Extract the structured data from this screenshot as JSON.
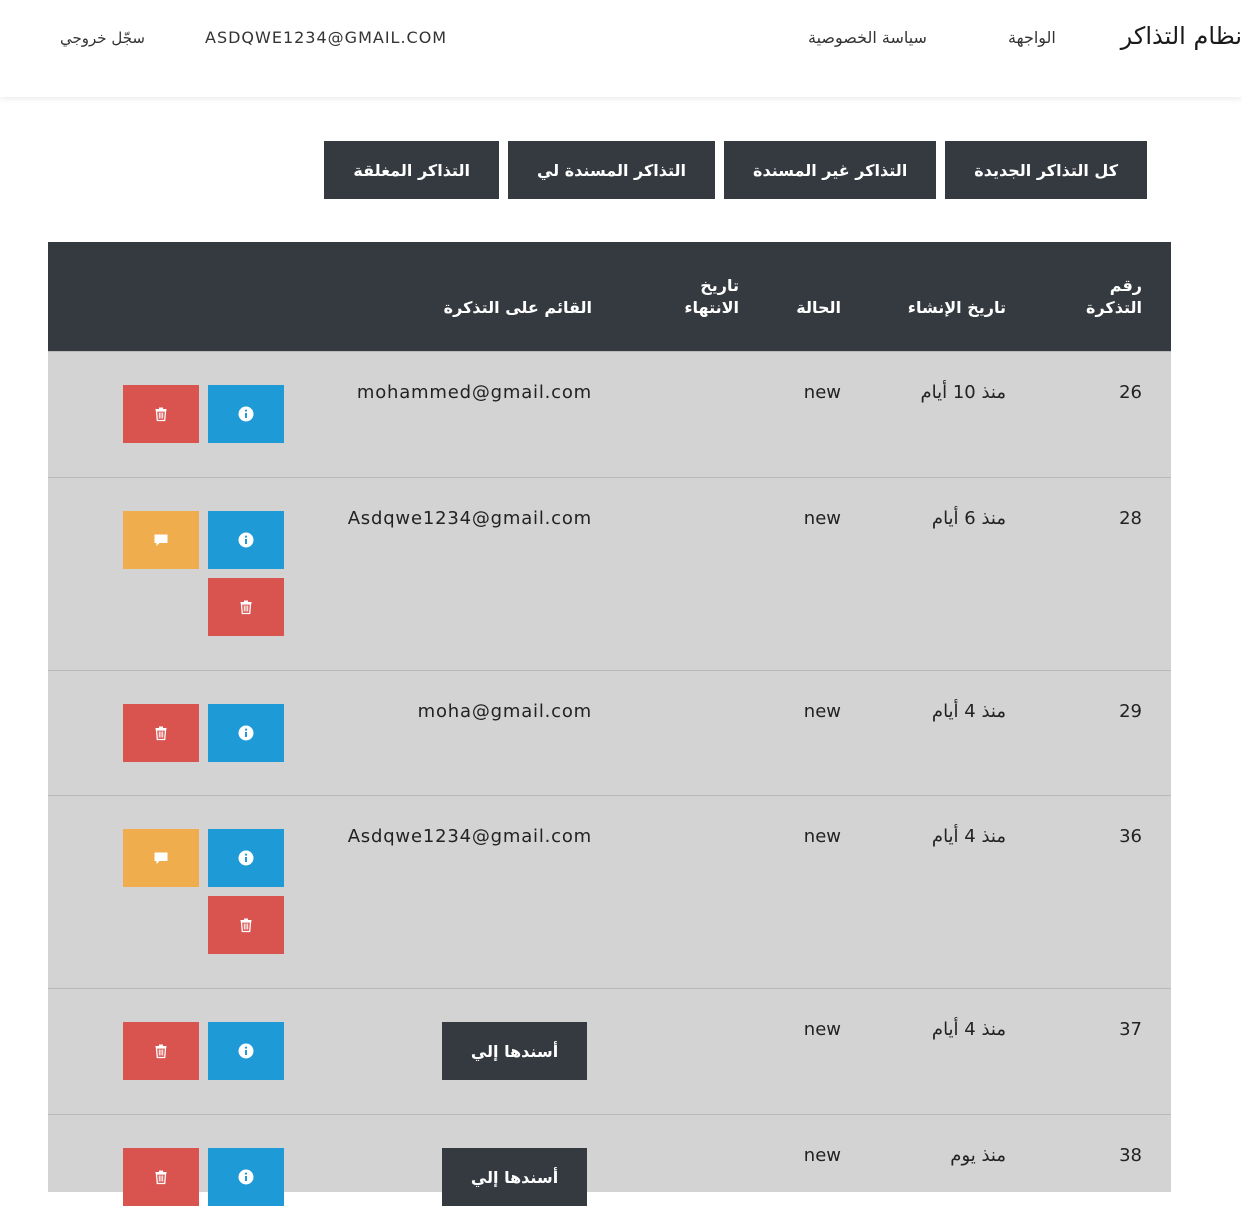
{
  "nav": {
    "brand": "نظام التذاكر",
    "home": "الواجهة",
    "privacy": "سياسة الخصوصية",
    "user_email": "ASDQWE1234@GMAIL.COM",
    "logout": "سجّل خروجي"
  },
  "filters": [
    "كل التذاكر الجديدة",
    "التذاكر غير المسندة",
    "التذاكر المسندة لي",
    "التذاكر المغلقة"
  ],
  "table": {
    "headers": {
      "id_line1": "رقم",
      "id_line2": "التذكرة",
      "created": "تاريخ الإنشاء",
      "status": "الحالة",
      "end_line1": "تاريخ",
      "end_line2": "الانتهاء",
      "owner": "القائم على التذكرة"
    },
    "assign_label": "أسندها إلي",
    "rows": [
      {
        "id": "26",
        "created": "منذ 10 أيام",
        "status": "new",
        "owner": "mohammed@gmail.com"
      },
      {
        "id": "28",
        "created": "منذ 6 أيام",
        "status": "new",
        "owner": "Asdqwe1234@gmail.com"
      },
      {
        "id": "29",
        "created": "منذ 4 أيام",
        "status": "new",
        "owner": "moha@gmail.com"
      },
      {
        "id": "36",
        "created": "منذ 4 أيام",
        "status": "new",
        "owner": "Asdqwe1234@gmail.com"
      },
      {
        "id": "37",
        "created": "منذ 4 أيام",
        "status": "new",
        "owner": ""
      },
      {
        "id": "38",
        "created": "منذ يوم",
        "status": "new",
        "owner": ""
      }
    ]
  },
  "icons": {
    "info": "info-circle-icon",
    "delete": "trash-icon",
    "chat": "comment-icon"
  },
  "colors": {
    "dark": "#343a40",
    "info": "#1e9ad6",
    "danger": "#d9534f",
    "warning": "#f0ad4e",
    "row_bg": "#d3d3d3"
  }
}
